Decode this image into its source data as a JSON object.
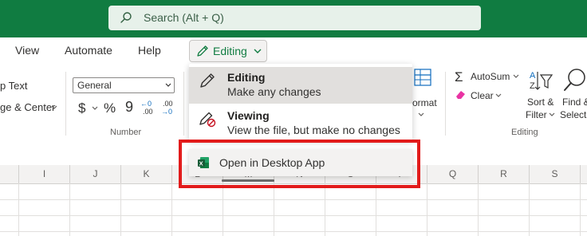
{
  "colors": {
    "brand": "#107c41",
    "highlight": "#e21b1b"
  },
  "search": {
    "placeholder": "Search (Alt + Q)",
    "icon": "search-icon"
  },
  "menu": {
    "view": "View",
    "automate": "Automate",
    "help": "Help",
    "editing_label": "Editing"
  },
  "ribbon": {
    "wrap_text": "p Text",
    "merge_center": "ge & Center",
    "number_format": "General",
    "currency": "$",
    "percent": "%",
    "comma": "9",
    "inc_decimal_top": "←0",
    "inc_decimal_bottom": ".00",
    "dec_decimal_top": ".00",
    "dec_decimal_bottom": "→0",
    "number_group": "Number",
    "format_label": "ormat",
    "autosum": "AutoSum",
    "clear": "Clear",
    "sort_filter_1": "Sort &",
    "sort_filter_2": "Filter",
    "find_select_1": "Find &",
    "find_select_2": "Select",
    "editing_group": "Editing"
  },
  "dropdown": {
    "editing": {
      "title": "Editing",
      "desc": "Make any changes"
    },
    "viewing": {
      "title": "Viewing",
      "desc": "View the file, but make no changes"
    },
    "open_desktop": "Open in Desktop App"
  },
  "grid": {
    "columns": [
      "I",
      "J",
      "K",
      "L",
      "M",
      "N",
      "O",
      "P",
      "Q",
      "R",
      "S"
    ]
  }
}
